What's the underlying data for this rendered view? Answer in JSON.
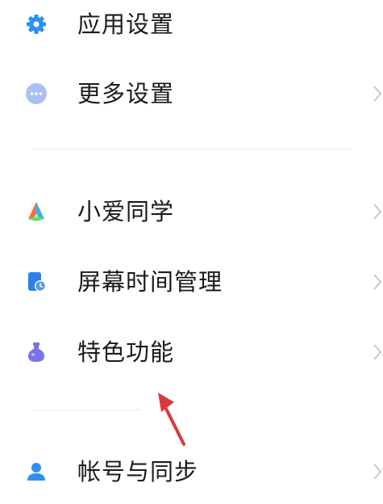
{
  "settings": {
    "items": [
      {
        "label": "应用设置",
        "icon": "gear-icon",
        "color": "#2f8ff0"
      },
      {
        "label": "更多设置",
        "icon": "more-dots-icon",
        "color": "#8fb2ef"
      },
      {
        "label": "小爱同学",
        "icon": "xiaoai-assistant-icon",
        "color": "#ff5a5f"
      },
      {
        "label": "屏幕时间管理",
        "icon": "screen-time-icon",
        "color": "#2f7fe8"
      },
      {
        "label": "特色功能",
        "icon": "potion-flask-icon",
        "color": "#7a72e8"
      },
      {
        "label": "帐号与同步",
        "icon": "person-icon",
        "color": "#2f8ff0"
      }
    ]
  },
  "annotation": {
    "arrow_icon": "red-arrow-icon",
    "color": "#d93a3a"
  }
}
